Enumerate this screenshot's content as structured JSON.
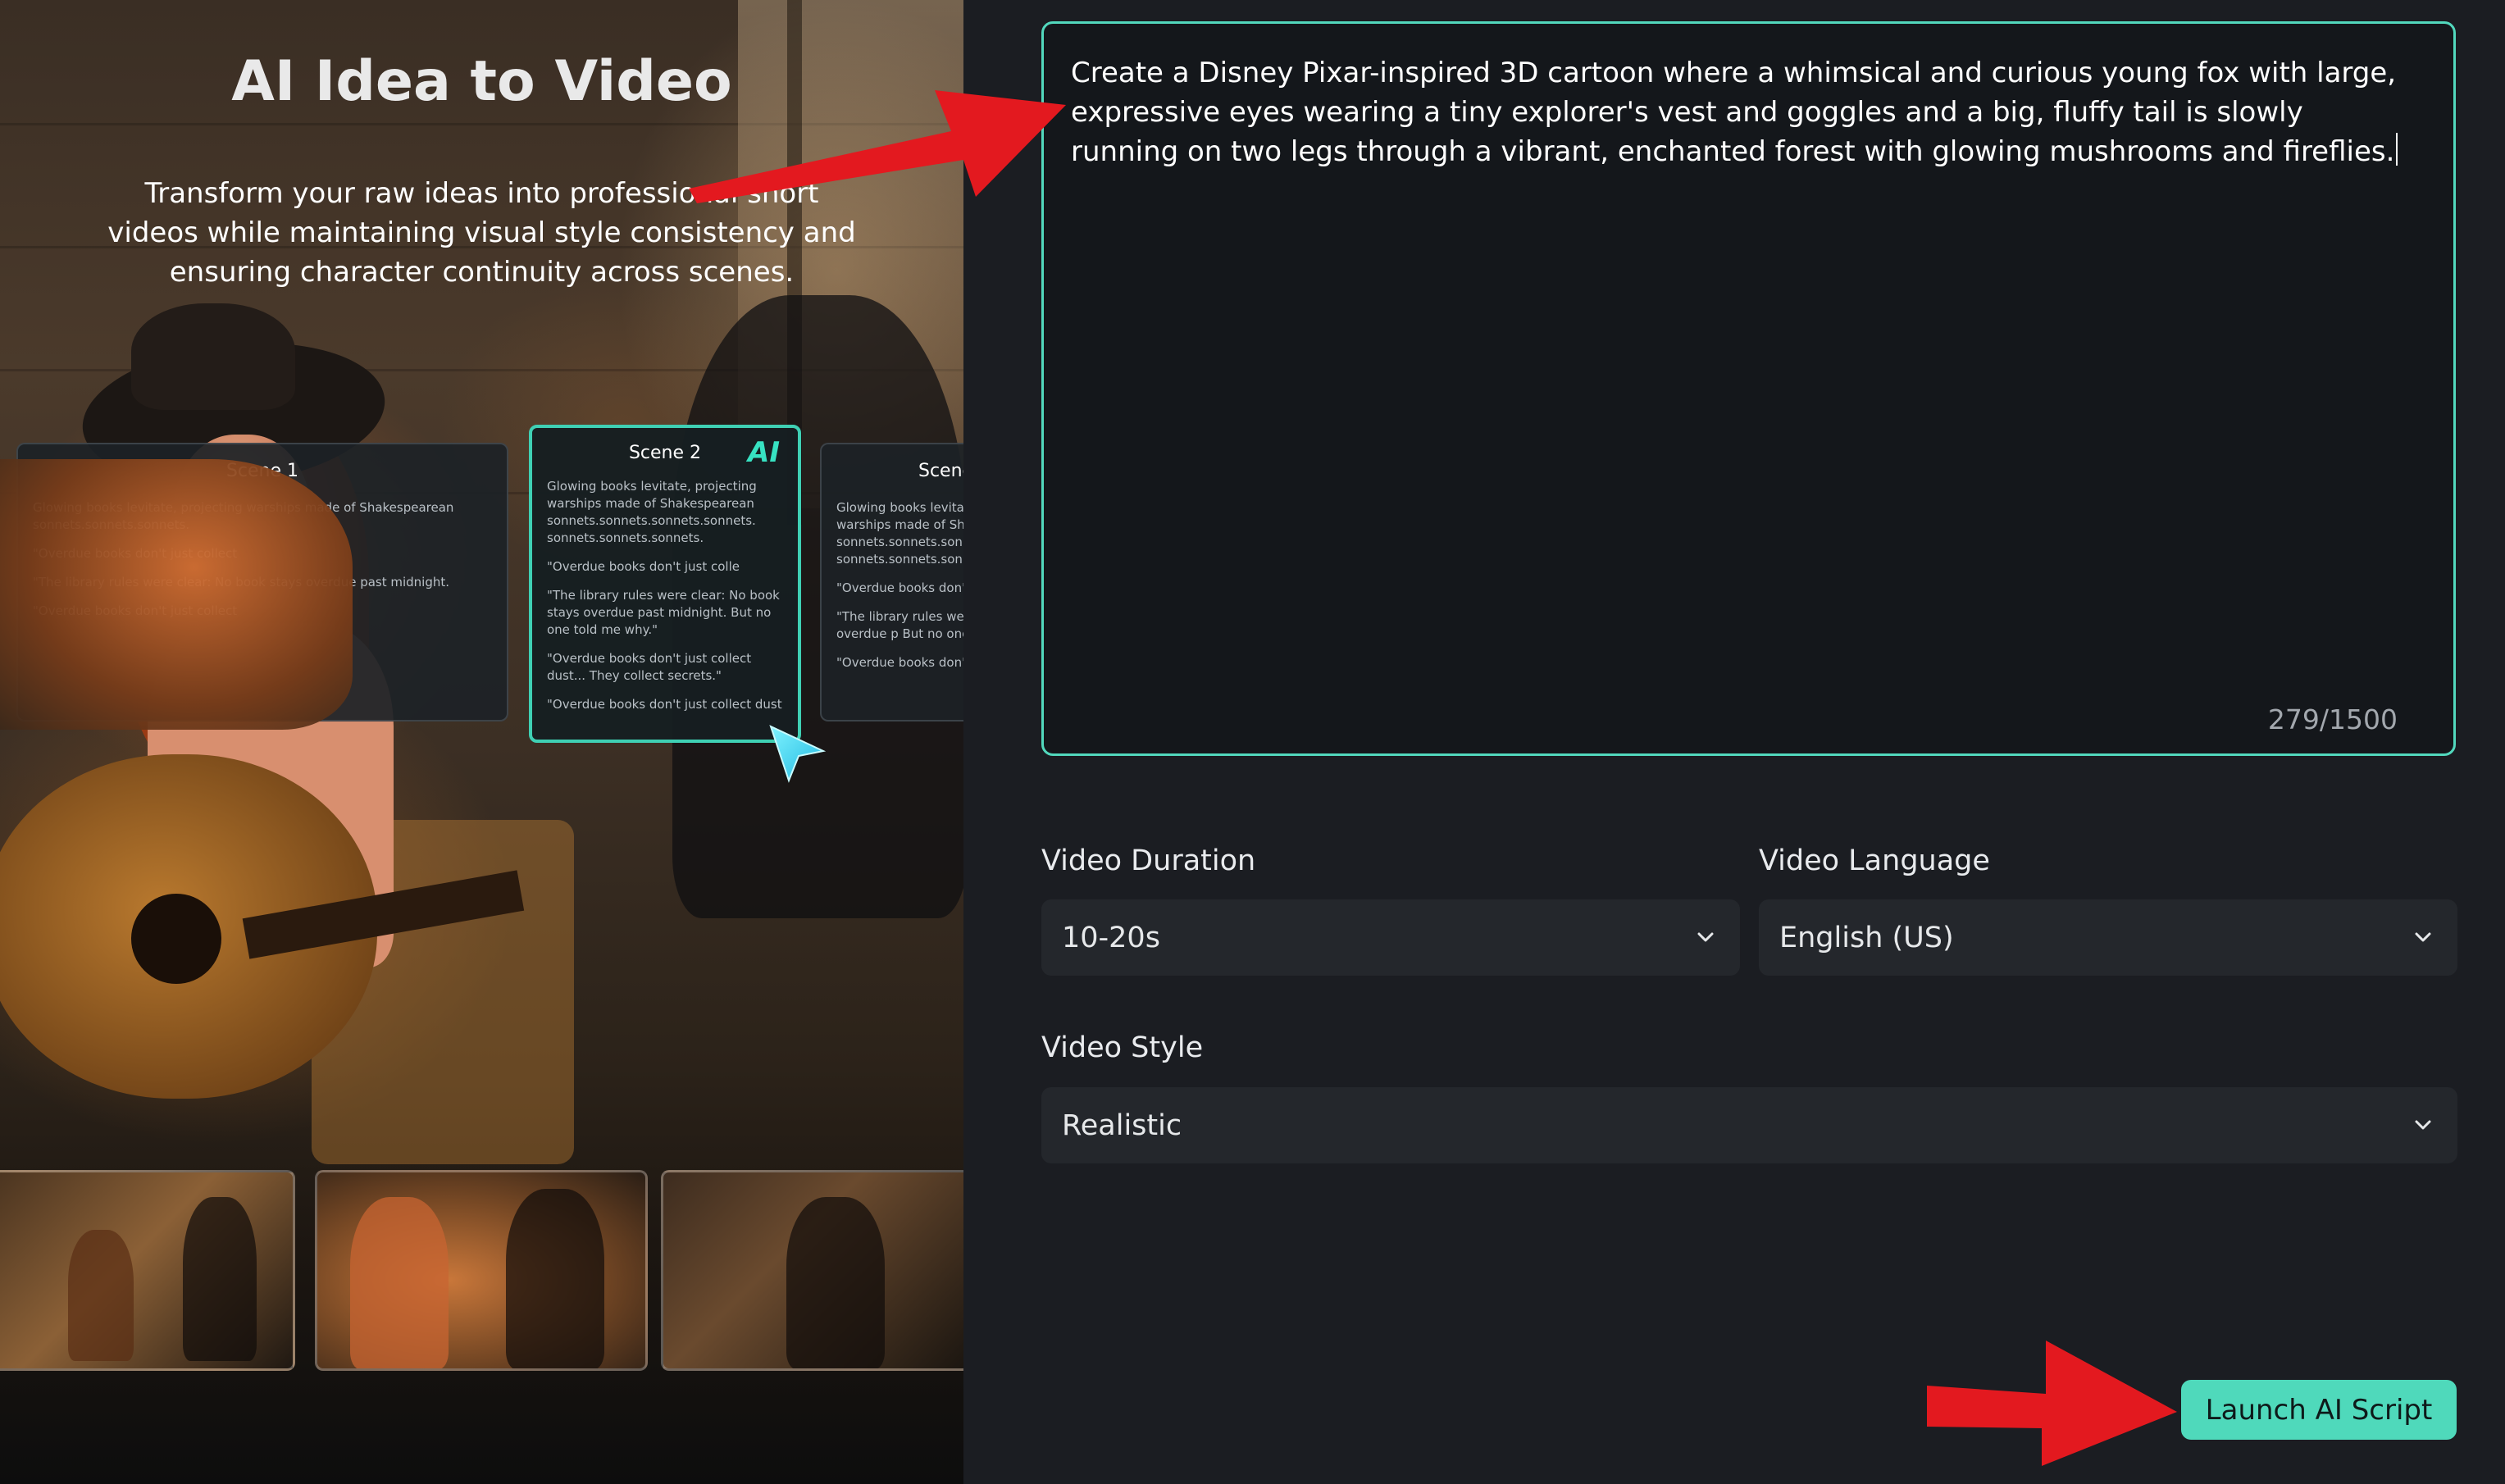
{
  "hero": {
    "title": "AI Idea to Video",
    "description": "Transform your raw ideas into professional short videos while maintaining visual style consistency and ensuring character continuity across scenes."
  },
  "scene_cards": [
    {
      "title": "Scene 1",
      "lines": [
        "Glowing books levitate, projecting warships made of Shakespearean sonnets.sonnets.sonnets.",
        "\"Overdue books don't just collect",
        "\"The library rules were clear: No book stays overdue past midnight.",
        "\"Overdue books don't just collect"
      ]
    },
    {
      "title": "Scene 2",
      "badge": "AI",
      "lines": [
        "Glowing books levitate, projecting warships made of Shakespearean sonnets.sonnets.sonnets.sonnets. sonnets.sonnets.sonnets.",
        "\"Overdue books don't just colle",
        "\"The library rules were clear: No book stays overdue past midnight. But no one told me why.\"",
        "\"Overdue books don't just collect dust... They collect secrets.\"",
        "\"Overdue books don't just collect dust"
      ]
    },
    {
      "title": "Scene",
      "lines": [
        "Glowing books levitate, projecting warships made of Sha sonnets.sonnets.sonnets sonnets.sonnets.sonn",
        "\"Overdue books don'",
        "\"The library rules were book stays overdue p But no one told me w",
        "\"Overdue books don'"
      ]
    }
  ],
  "prompt": {
    "text": "Create a Disney Pixar-inspired 3D cartoon where a whimsical and curious young fox with large, expressive eyes wearing a tiny explorer's vest and goggles and a big, fluffy tail is slowly running on two legs through a vibrant, enchanted forest with glowing mushrooms and fireflies.",
    "char_count": "279/1500"
  },
  "fields": {
    "duration": {
      "label": "Video Duration",
      "value": "10-20s"
    },
    "language": {
      "label": "Video Language",
      "value": "English (US)"
    },
    "style": {
      "label": "Video Style",
      "value": "Realistic"
    }
  },
  "launch_button": {
    "label": "Launch AI Script"
  },
  "colors": {
    "accent": "#4fd9bb",
    "panel_bg": "#1b1d22",
    "field_bg": "#24272c",
    "annotation": "#e3191f"
  },
  "icons": {
    "chevron": "chevron-down-icon",
    "cursor": "pointer-cursor-icon",
    "annotation": "red-arrow-icon"
  }
}
